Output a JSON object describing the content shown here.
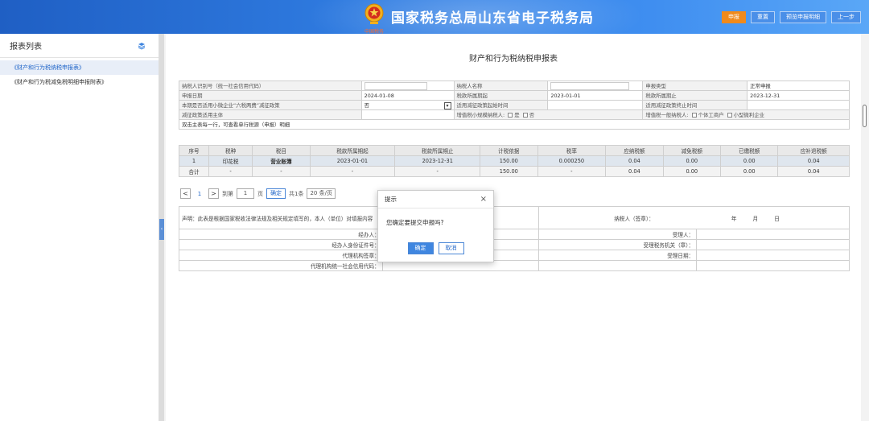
{
  "header": {
    "emblem_caption": "中国税务",
    "title": "国家税务总局山东省电子税务局",
    "buttons": {
      "declare": "申报",
      "reset": "重置",
      "preview": "预览申报明细",
      "back": "上一步"
    }
  },
  "sidebar": {
    "title": "报表列表",
    "items": [
      {
        "label": "《财产和行为税纳税申报表》"
      },
      {
        "label": "《财产和行为税减免税明细申报附表》"
      }
    ]
  },
  "form": {
    "title": "财产和行为税纳税申报表",
    "rows": {
      "taxpayer_id_label": "纳税人识别号（统一社会信用代码）",
      "taxpayer_name_label": "纳税人名称",
      "declare_type_label": "申报类型",
      "declare_type_value": "正常申报",
      "fill_date_label": "申报日期",
      "fill_date_value": "2024-01-08",
      "period_start_label": "税款所属期起",
      "period_start_value": "2023-01-01",
      "period_end_label": "税款所属期止",
      "period_end_value": "2023-12-31",
      "small_biz_label": "本期是否适用小微企业“六税两费”减征政策",
      "small_biz_value": "否",
      "reduce_start_label": "适用减征政策起始时间",
      "reduce_end_label": "适用减征政策终止时间",
      "reduce_subject_label": "减征政策适用主体",
      "vat_small_label": "增值税小规模纳税人:",
      "yes": "是",
      "no": "否",
      "vat_general_label": "增值税一般纳税人:",
      "individual": "个体工商户",
      "micro": "小型微利企业",
      "hint": "双击主表每一行，可查看单行税源（申报）明细"
    }
  },
  "table": {
    "headers": [
      "序号",
      "税种",
      "税目",
      "税款所属期起",
      "税款所属期止",
      "计税依据",
      "税率",
      "应纳税额",
      "减免税额",
      "已缴税额",
      "应补退税额"
    ],
    "rows": [
      [
        "1",
        "印花税",
        "营业账簿",
        "2023-01-01",
        "2023-12-31",
        "150.00",
        "0.000250",
        "0.04",
        "0.00",
        "0.00",
        "0.04"
      ],
      [
        "合计",
        "-",
        "-",
        "-",
        "-",
        "150.00",
        "-",
        "0.04",
        "0.00",
        "0.00",
        "0.04"
      ]
    ]
  },
  "pager": {
    "prev": "<",
    "current": "1",
    "next": ">",
    "goto": "到第",
    "page_input": "1",
    "page_unit": "页",
    "confirm": "确定",
    "total": "共1条",
    "size": "20 条/页"
  },
  "declaration": {
    "statement": "声明：此表是根据国家税收法律法规及相关规定填写的，本人（单位）对填报内容",
    "signer": "纳税人（签章）：",
    "year": "年",
    "month": "月",
    "day": "日",
    "agent": "经办人：",
    "agent_id": "经办人身份证件号：",
    "agency_seal": "代理机构签章：",
    "agency_code": "代理机构统一社会信用代码：",
    "receiver": "受理人：",
    "receiving_office": "受理税务机关（章）：",
    "receive_date": "受理日期："
  },
  "modal": {
    "title": "提示",
    "close": "×",
    "message": "您确定要提交申报吗?",
    "ok": "确定",
    "cancel": "取消"
  }
}
